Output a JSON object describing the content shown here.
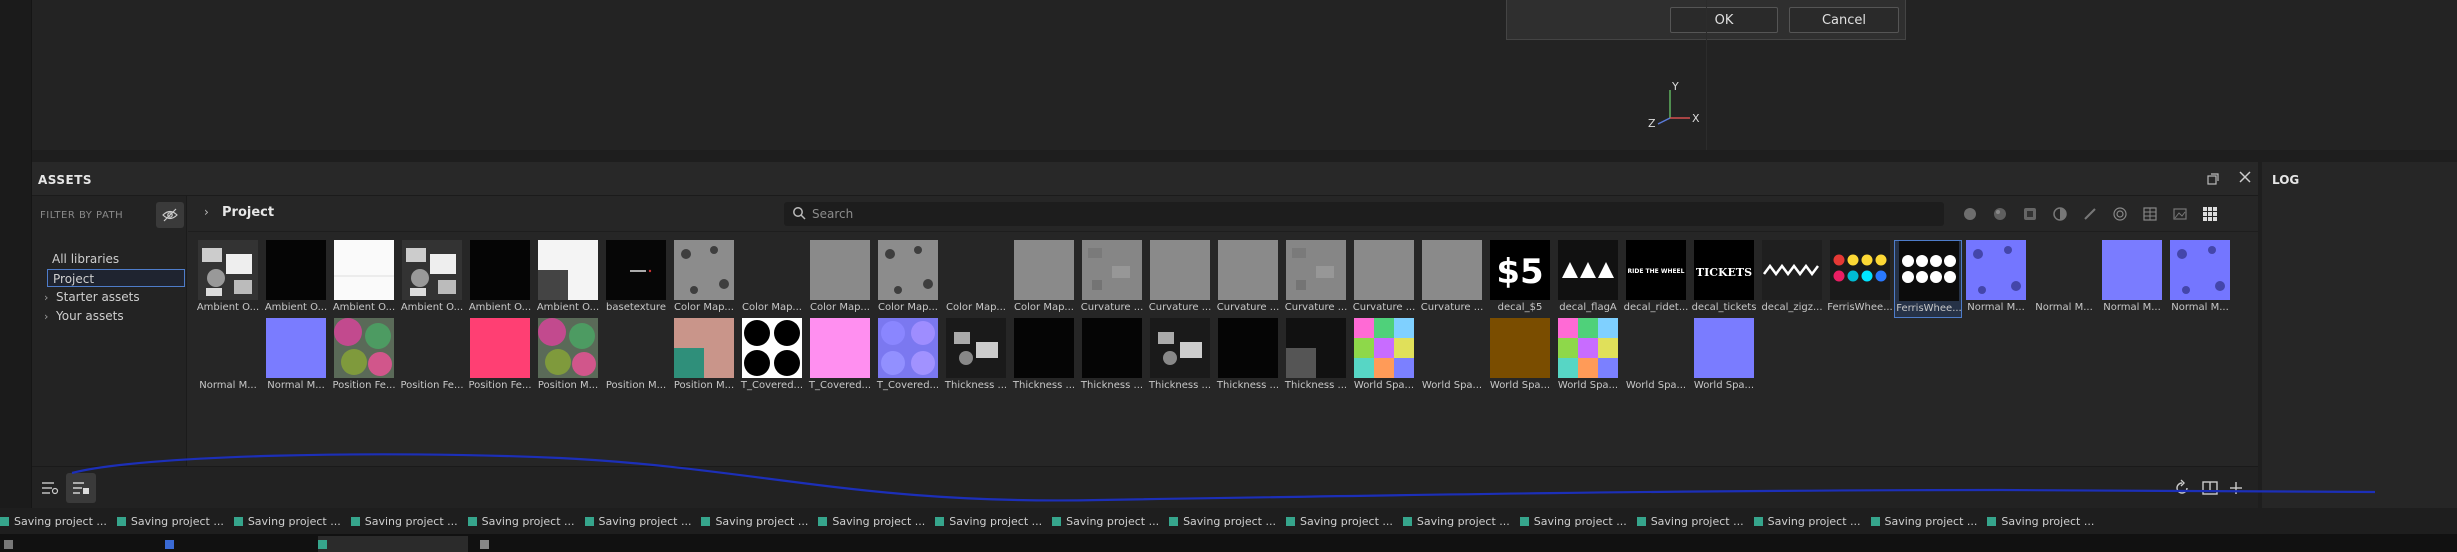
{
  "dialog": {
    "ok_label": "OK",
    "cancel_label": "Cancel"
  },
  "gizmo": {
    "x": "X",
    "y": "Y",
    "z": "Z"
  },
  "assets": {
    "title": "ASSETS",
    "filter_label": "FILTER BY PATH",
    "tree": {
      "all": "All libraries",
      "project": "Project",
      "starter": "Starter assets",
      "yours": "Your assets"
    },
    "breadcrumb": "Project",
    "search_placeholder": "Search",
    "row1": [
      {
        "caption": "Ambient O...",
        "kind": "noise"
      },
      {
        "caption": "Ambient O...",
        "kind": "black"
      },
      {
        "caption": "Ambient O...",
        "kind": "white"
      },
      {
        "caption": "Ambient O...",
        "kind": "noise"
      },
      {
        "caption": "Ambient O...",
        "kind": "black"
      },
      {
        "caption": "Ambient O...",
        "kind": "whitecorner"
      },
      {
        "caption": "basetexture",
        "kind": "blackdot"
      },
      {
        "caption": "Color Map...",
        "kind": "greyholes"
      },
      {
        "caption": "Color Map...",
        "kind": "none"
      },
      {
        "caption": "Color Map...",
        "kind": "grey"
      },
      {
        "caption": "Color Map...",
        "kind": "greyholes"
      },
      {
        "caption": "Color Map...",
        "kind": "none"
      },
      {
        "caption": "Color Map...",
        "kind": "grey"
      },
      {
        "caption": "Curvature ...",
        "kind": "greynoise"
      },
      {
        "caption": "Curvature ...",
        "kind": "grey"
      },
      {
        "caption": "Curvature ...",
        "kind": "grey"
      },
      {
        "caption": "Curvature ...",
        "kind": "greynoise"
      },
      {
        "caption": "Curvature ...",
        "kind": "grey"
      },
      {
        "caption": "Curvature ...",
        "kind": "grey"
      },
      {
        "caption": "decal_$5",
        "kind": "dollar",
        "text": "$5"
      },
      {
        "caption": "decal_flagA",
        "kind": "flags"
      },
      {
        "caption": "decal_ridet...",
        "kind": "ridetext",
        "text": "RIDE THE WHEEL"
      },
      {
        "caption": "decal_tickets",
        "kind": "tickets",
        "text": "TICKETS"
      },
      {
        "caption": "decal_zigz...",
        "kind": "zigzag"
      },
      {
        "caption": "FerrisWhee...",
        "kind": "dotscolor"
      },
      {
        "caption": "FerrisWhee...",
        "kind": "dotswhite",
        "selected": true
      },
      {
        "caption": "Normal M...",
        "kind": "blueholes"
      },
      {
        "caption": "Normal M...",
        "kind": "none"
      },
      {
        "caption": "Normal M...",
        "kind": "blue"
      },
      {
        "caption": "Normal M...",
        "kind": "blueholes"
      }
    ],
    "row2": [
      {
        "caption": "Normal M...",
        "kind": "none"
      },
      {
        "caption": "Normal M...",
        "kind": "blue"
      },
      {
        "caption": "Position Fe...",
        "kind": "posfe"
      },
      {
        "caption": "Position Fe...",
        "kind": "none"
      },
      {
        "caption": "Position Fe...",
        "kind": "pink"
      },
      {
        "caption": "Position M...",
        "kind": "posfe"
      },
      {
        "caption": "Position M...",
        "kind": "none"
      },
      {
        "caption": "Position M...",
        "kind": "posm"
      },
      {
        "caption": "T_Covered...",
        "kind": "circles"
      },
      {
        "caption": "T_Covered...",
        "kind": "lightpink"
      },
      {
        "caption": "T_Covered...",
        "kind": "bluecells"
      },
      {
        "caption": "Thickness ...",
        "kind": "darknoise"
      },
      {
        "caption": "Thickness ...",
        "kind": "black"
      },
      {
        "caption": "Thickness ...",
        "kind": "black"
      },
      {
        "caption": "Thickness ...",
        "kind": "darknoise"
      },
      {
        "caption": "Thickness ...",
        "kind": "black"
      },
      {
        "caption": "Thickness ...",
        "kind": "darkcorner"
      },
      {
        "caption": "World Spa...",
        "kind": "worldmix"
      },
      {
        "caption": "World Spa...",
        "kind": "none"
      },
      {
        "caption": "World Spa...",
        "kind": "brown"
      },
      {
        "caption": "World Spa...",
        "kind": "worldmix"
      },
      {
        "caption": "World Spa...",
        "kind": "none"
      },
      {
        "caption": "World Spa...",
        "kind": "blue"
      }
    ]
  },
  "log": {
    "title": "LOG"
  },
  "status_item_text": "Saving project ...",
  "status_count": 18
}
